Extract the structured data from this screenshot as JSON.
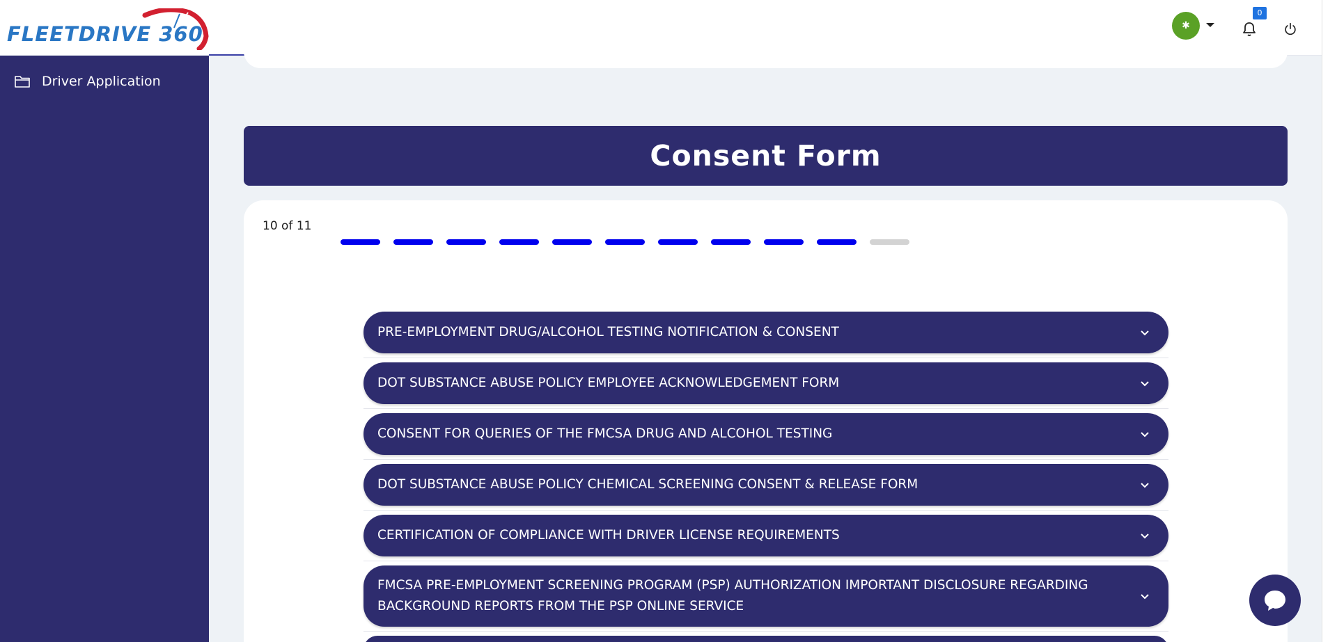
{
  "header": {
    "logo_text": "FLEETDRIVE 360",
    "avatar_text": "✱",
    "notification_count": "0",
    "icons": [
      "user-menu-caret-icon",
      "bell-icon",
      "power-icon"
    ]
  },
  "sidebar": {
    "items": [
      {
        "label": "Driver Application",
        "icon": "folder-icon"
      }
    ]
  },
  "main": {
    "title": "Consent Form",
    "step_label": "10 of 11",
    "steps_total": 11,
    "steps_completed": 10,
    "accordions": [
      {
        "label": "PRE-EMPLOYMENT DRUG/ALCOHOL TESTING NOTIFICATION & CONSENT"
      },
      {
        "label": "DOT SUBSTANCE ABUSE POLICY EMPLOYEE ACKNOWLEDGEMENT FORM"
      },
      {
        "label": "CONSENT FOR QUERIES OF THE FMCSA DRUG AND ALCOHOL TESTING"
      },
      {
        "label": "DOT SUBSTANCE ABUSE POLICY CHEMICAL SCREENING CONSENT & RELEASE FORM"
      },
      {
        "label": "CERTIFICATION OF COMPLIANCE WITH DRIVER LICENSE REQUIREMENTS"
      },
      {
        "label": "FMCSA PRE-EMPLOYMENT SCREENING PROGRAM (PSP) AUTHORIZATION IMPORTANT DISCLOSURE REGARDING BACKGROUND REPORTS FROM THE PSP ONLINE SERVICE"
      }
    ]
  },
  "colors": {
    "primary": "#2e2c6e",
    "step_active": "#0000ee",
    "step_inactive": "#d3d3d3",
    "avatar": "#5aa126",
    "badge": "#1f73e0"
  }
}
